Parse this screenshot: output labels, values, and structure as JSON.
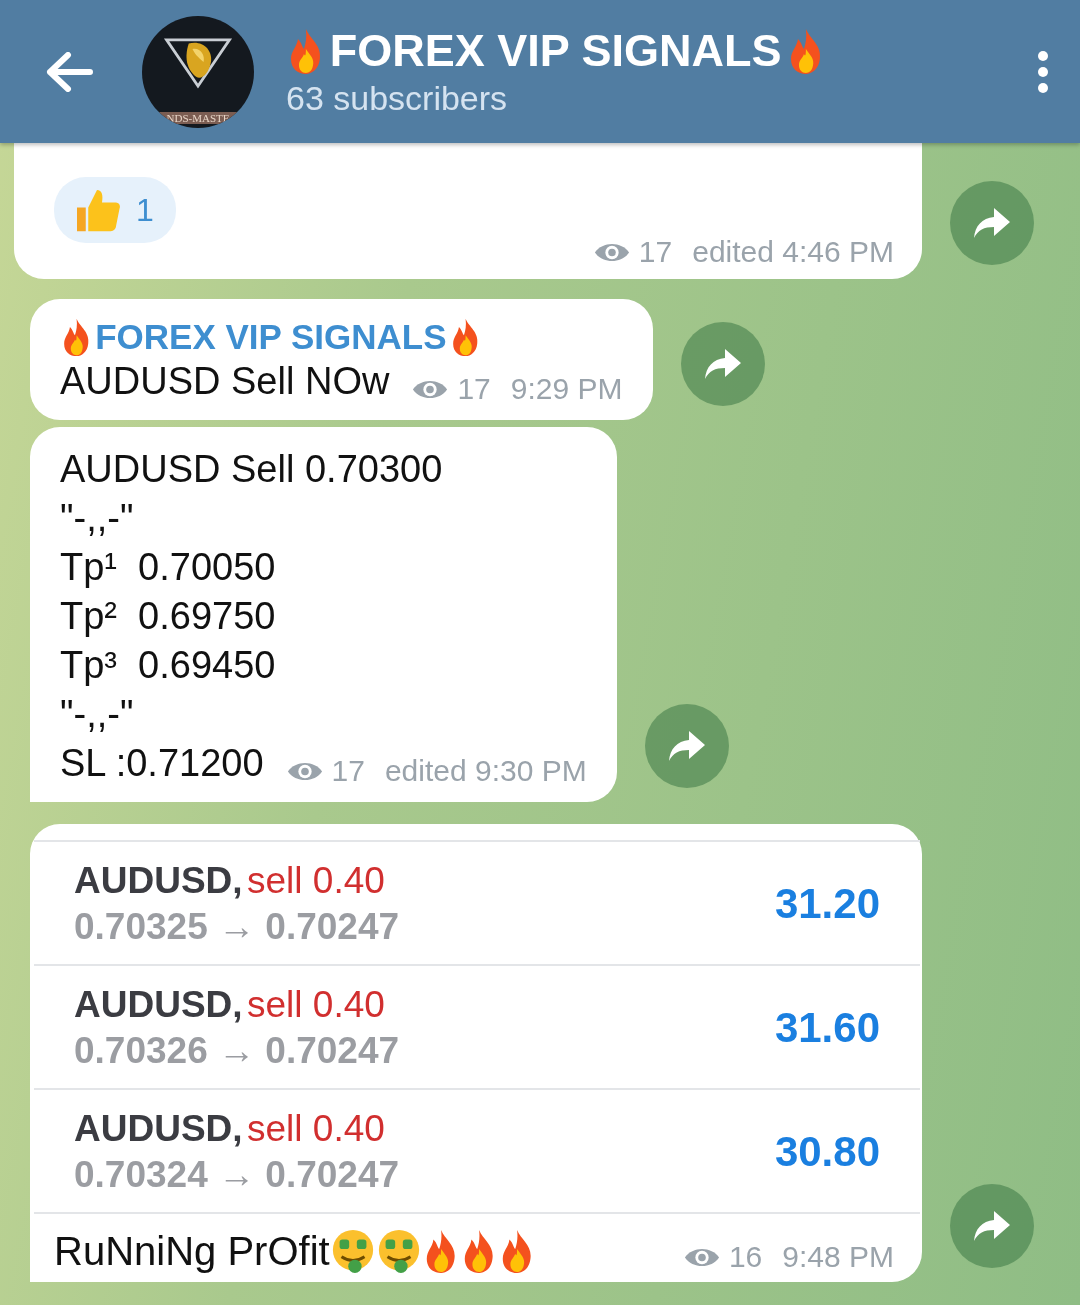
{
  "header": {
    "title": "FOREX VIP SIGNALS",
    "subscribers": "63 subscribers",
    "logo_text": "NDS-MASTE"
  },
  "messages": [
    {
      "kind": "reaction",
      "reaction_count": "1",
      "views": "17",
      "time": "edited 4:46 PM"
    },
    {
      "kind": "text",
      "title": "FOREX VIP SIGNALS",
      "lines": [
        "AUDUSD Sell NOw"
      ],
      "views": "17",
      "time": "9:29 PM"
    },
    {
      "kind": "text",
      "lines": [
        "AUDUSD Sell 0.70300",
        "\"-,,-\"",
        "Tp¹  0.70050",
        "Tp²  0.69750",
        "Tp³  0.69450",
        "\"-,,-\"",
        "SL :0.71200"
      ],
      "views": "17",
      "time": "edited 9:30 PM"
    },
    {
      "kind": "trades",
      "trades": [
        {
          "symbol": "AUDUSD,",
          "order": "sell 0.40",
          "prices": "0.70325 → 0.70247",
          "profit": "31.20"
        },
        {
          "symbol": "AUDUSD,",
          "order": "sell 0.40",
          "prices": "0.70326 → 0.70247",
          "profit": "31.60"
        },
        {
          "symbol": "AUDUSD,",
          "order": "sell 0.40",
          "prices": "0.70324 → 0.70247",
          "profit": "30.80"
        }
      ],
      "caption": "RuNniNg PrOfit",
      "views": "16",
      "time": "9:48 PM"
    }
  ]
}
